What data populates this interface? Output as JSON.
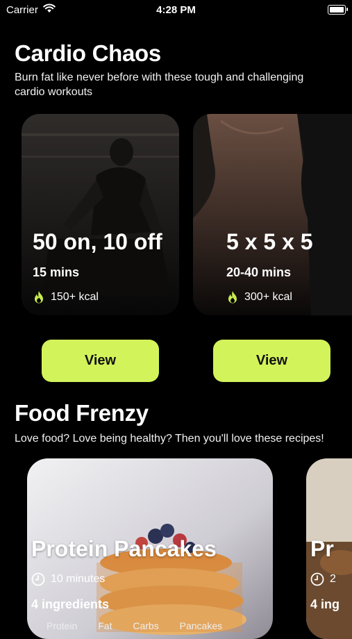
{
  "status_bar": {
    "carrier": "Carrier",
    "time": "4:28 PM"
  },
  "cardio": {
    "title": "Cardio Chaos",
    "description": "Burn fat like never before with these tough and challenging cardio workouts",
    "cards": [
      {
        "title": "50 on, 10 off",
        "duration": "15 mins",
        "kcal": "150+ kcal",
        "button": "View"
      },
      {
        "title": "5 x 5 x 5",
        "duration": "20-40 mins",
        "kcal": "300+ kcal",
        "button": "View"
      }
    ]
  },
  "food": {
    "title": "Food Frenzy",
    "description": "Love food? Love being healthy? Then you'll love these recipes!",
    "cards": [
      {
        "title": "Protein Pancakes",
        "time": "10 minutes",
        "ingredients": "4 ingredients",
        "macros": [
          "Protein",
          "Fat",
          "Carbs",
          "Pancakes"
        ]
      },
      {
        "title": "Pr",
        "time": "2",
        "ingredients": "4 ing"
      }
    ]
  },
  "colors": {
    "accent": "#d3f35a",
    "flame": "#c9ec4f",
    "background": "#000000"
  }
}
